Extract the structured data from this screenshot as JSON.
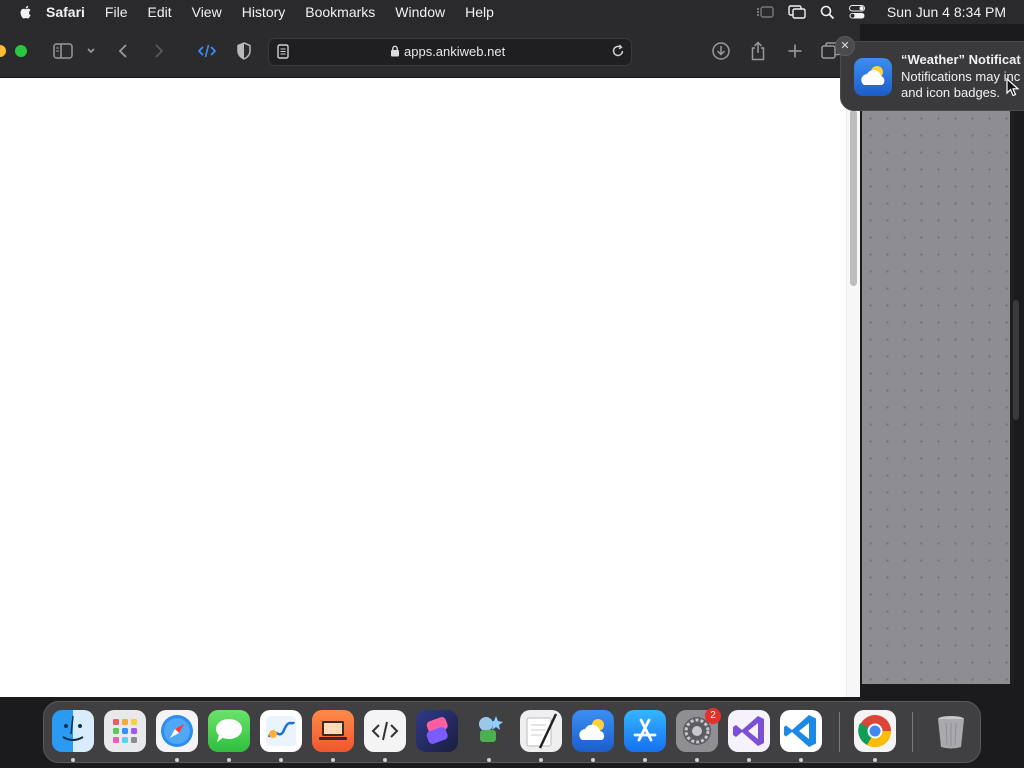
{
  "menubar": {
    "app_name": "Safari",
    "items": [
      "File",
      "Edit",
      "View",
      "History",
      "Bookmarks",
      "Window",
      "Help"
    ],
    "clock": "Sun Jun 4  8:34 PM",
    "status_icons": [
      "stage-manager-icon",
      "screen-mirroring-icon",
      "spotlight-search-icon",
      "control-center-icon"
    ]
  },
  "safari": {
    "url": "apps.ankiweb.net"
  },
  "notification": {
    "title": "“Weather” Notificat",
    "body_line1": "Notifications may inc",
    "body_line2": "and icon badges.",
    "close_label": "✕"
  },
  "dock": {
    "apps": [
      "Finder",
      "Launchpad",
      "Safari",
      "Messages",
      "Freeform",
      "Keynote",
      "Script Editor",
      "Shortcuts",
      "Automator",
      "Script Editor 2",
      "Weather",
      "App Store",
      "System Settings",
      "Visual Studio",
      "Visual Studio Code",
      "Google Chrome",
      "Trash"
    ],
    "system_settings_badge": "2"
  },
  "colors": {
    "accent": "#2f7bf5",
    "menubar_bg": "#2a2a2c",
    "toolbar_bg": "#2b2b2d"
  }
}
